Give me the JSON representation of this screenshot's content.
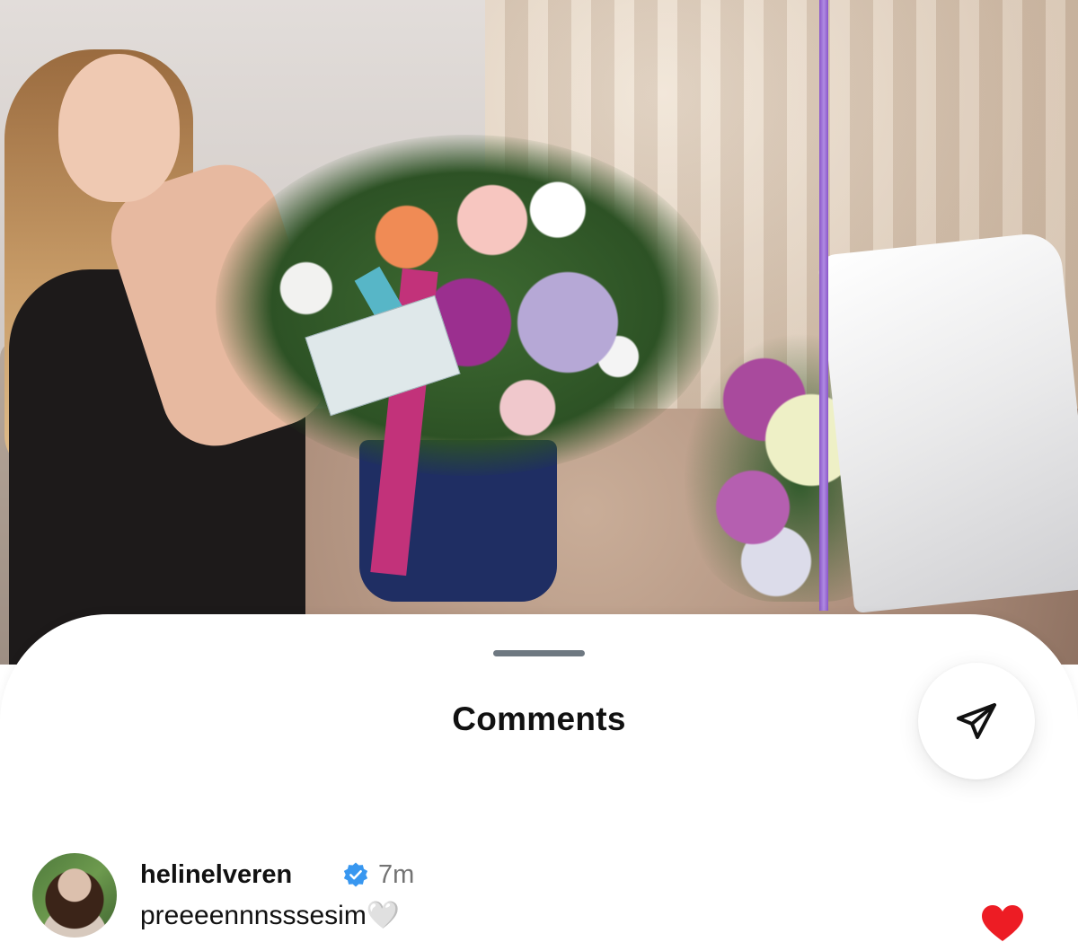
{
  "photo": {
    "content": "photo"
  },
  "sheet": {
    "title": "Comments"
  },
  "comment": {
    "username": "helinelveren",
    "time": "7m",
    "text": "preeeennnsssesim",
    "emoji": "🤍",
    "verified": true
  },
  "colors": {
    "verified_blue": "#3897f0",
    "like_red": "#ed1c24",
    "handle_gray": "#6e7881"
  },
  "icons": [
    "send-icon",
    "verified-badge-icon",
    "heart-icon"
  ]
}
